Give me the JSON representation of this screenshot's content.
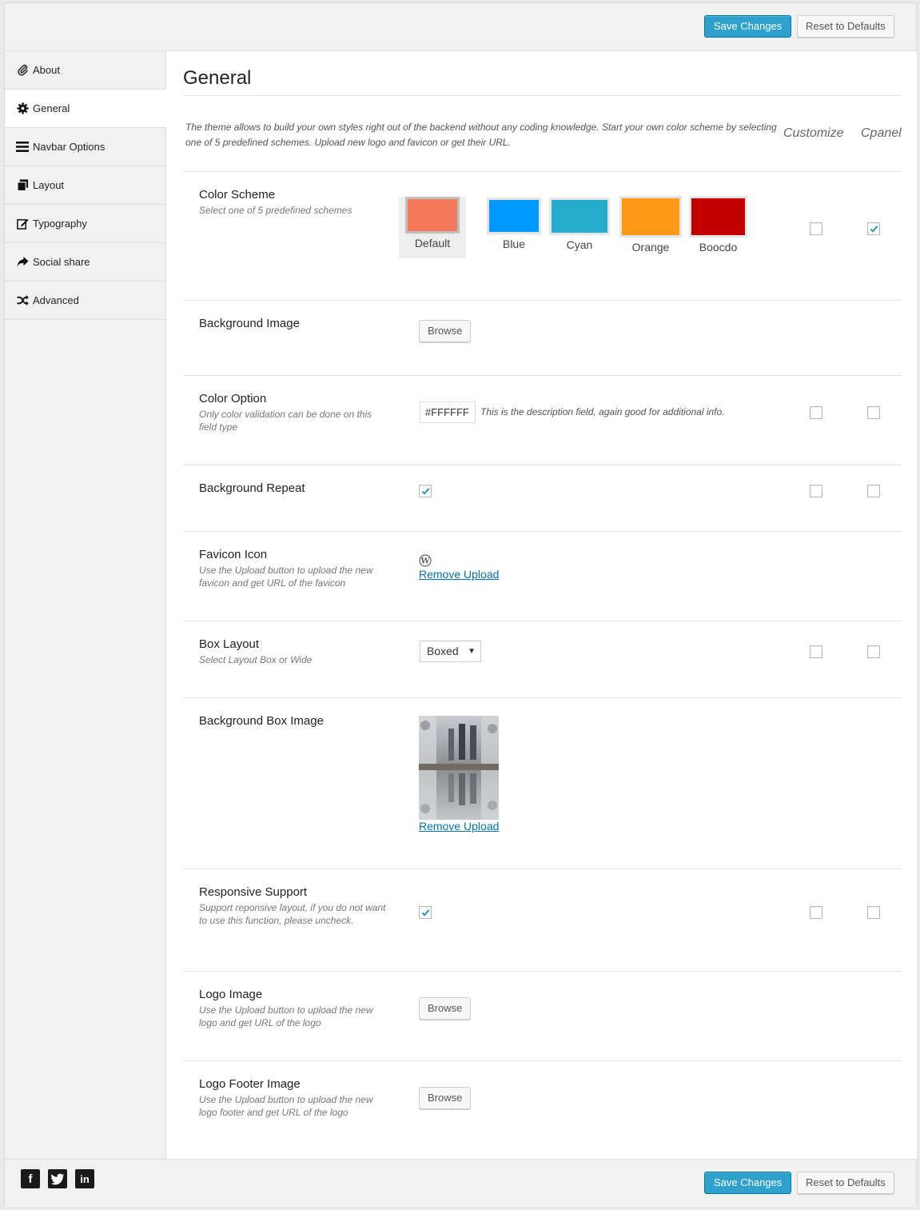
{
  "toolbar": {
    "save_label": "Save Changes",
    "reset_label": "Reset to Defaults"
  },
  "sidebar": {
    "items": [
      {
        "label": "About",
        "icon": "paperclip-icon"
      },
      {
        "label": "General",
        "icon": "gear-icon",
        "active": true
      },
      {
        "label": "Navbar Options",
        "icon": "menu-icon"
      },
      {
        "label": "Layout",
        "icon": "copy-icon"
      },
      {
        "label": "Typography",
        "icon": "edit-icon"
      },
      {
        "label": "Social share",
        "icon": "share-icon"
      },
      {
        "label": "Advanced",
        "icon": "shuffle-icon"
      }
    ]
  },
  "main": {
    "title": "General",
    "intro": "The theme allows to build your own styles right out of the backend without any coding knowledge. Start your own color scheme by selecting one of 5 predefined schemes. Upload new logo and favicon or get their URL.",
    "columns": {
      "customize": "Customize",
      "cpanel": "Cpanel"
    }
  },
  "fields": {
    "color_scheme": {
      "label": "Color Scheme",
      "desc": "Select one of 5 predefined schemes",
      "schemes": [
        {
          "name": "Default",
          "color": "#f4795b"
        },
        {
          "name": "Blue",
          "color": "#0099ff"
        },
        {
          "name": "Cyan",
          "color": "#26adce"
        },
        {
          "name": "Orange",
          "color": "#ff9a17"
        },
        {
          "name": "Boocdo",
          "color": "#c20000"
        }
      ],
      "selected": "Default",
      "customize": false,
      "cpanel": true
    },
    "background_image": {
      "label": "Background Image",
      "browse": "Browse"
    },
    "color_option": {
      "label": "Color Option",
      "desc": "Only color validation can be done on this field type",
      "value": "#FFFFFF",
      "note": "This is the description field, again good for additional info.",
      "customize": false,
      "cpanel": false
    },
    "background_repeat": {
      "label": "Background Repeat",
      "checked": true,
      "customize": false,
      "cpanel": false
    },
    "favicon_icon": {
      "label": "Favicon Icon",
      "desc": "Use the Upload button to upload the new favicon and get URL of the favicon",
      "remove": "Remove Upload"
    },
    "box_layout": {
      "label": "Box Layout",
      "desc": "Select Layout Box or Wide",
      "value": "Boxed",
      "customize": false,
      "cpanel": false
    },
    "background_box_image": {
      "label": "Background Box Image",
      "remove": "Remove Upload"
    },
    "responsive_support": {
      "label": "Responsive Support",
      "desc": "Support reponsive layout, if you do not want to use this function, please uncheck.",
      "checked": true,
      "customize": false,
      "cpanel": false
    },
    "logo_image": {
      "label": "Logo Image",
      "desc": "Use the Upload button to upload the new logo and get URL of the logo",
      "browse": "Browse"
    },
    "logo_footer_image": {
      "label": "Logo Footer Image",
      "desc": "Use the Upload button to upload the new logo footer and get URL of the logo",
      "browse": "Browse"
    }
  },
  "footer": {
    "social": [
      {
        "label": "f",
        "icon": "facebook-icon"
      },
      {
        "label": "t",
        "icon": "twitter-icon"
      },
      {
        "label": "in",
        "icon": "linkedin-icon"
      }
    ]
  },
  "colors": {
    "accent": "#2ea2cc",
    "link": "#0073aa"
  }
}
